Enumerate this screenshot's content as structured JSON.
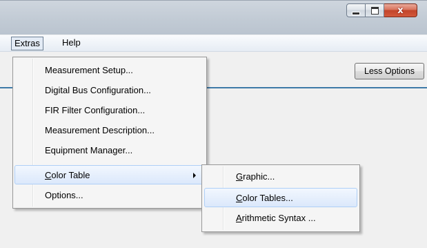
{
  "window": {
    "caption_buttons": {
      "minimize_icon": "minimize-icon",
      "maximize_icon": "maximize-icon",
      "close_glyph": "x",
      "close_color": "#c7472b"
    }
  },
  "menubar": {
    "items": [
      {
        "label": "Extras",
        "open": true
      },
      {
        "label": "Help"
      }
    ]
  },
  "toolbar": {
    "less_options_label": "Less Options"
  },
  "extras_menu": {
    "items": [
      {
        "label": "Measurement Setup..."
      },
      {
        "label": "Digital Bus Configuration..."
      },
      {
        "label": "FIR Filter Configuration..."
      },
      {
        "label": "Measurement Description..."
      },
      {
        "label": "Equipment Manager..."
      },
      {
        "label_accel": "C",
        "label_rest": "olor Table",
        "highlighted": true,
        "has_submenu": true
      },
      {
        "label": "Options..."
      }
    ]
  },
  "color_table_submenu": {
    "items": [
      {
        "label_accel": "G",
        "label_rest": "raphic..."
      },
      {
        "label_accel": "C",
        "label_rest": "olor Tables...",
        "highlighted": true
      },
      {
        "label_accel": "A",
        "label_rest": "rithmetic Syntax ..."
      }
    ]
  },
  "colors": {
    "highlight_border": "#aecff7",
    "accent_line": "#3e7aa8"
  }
}
